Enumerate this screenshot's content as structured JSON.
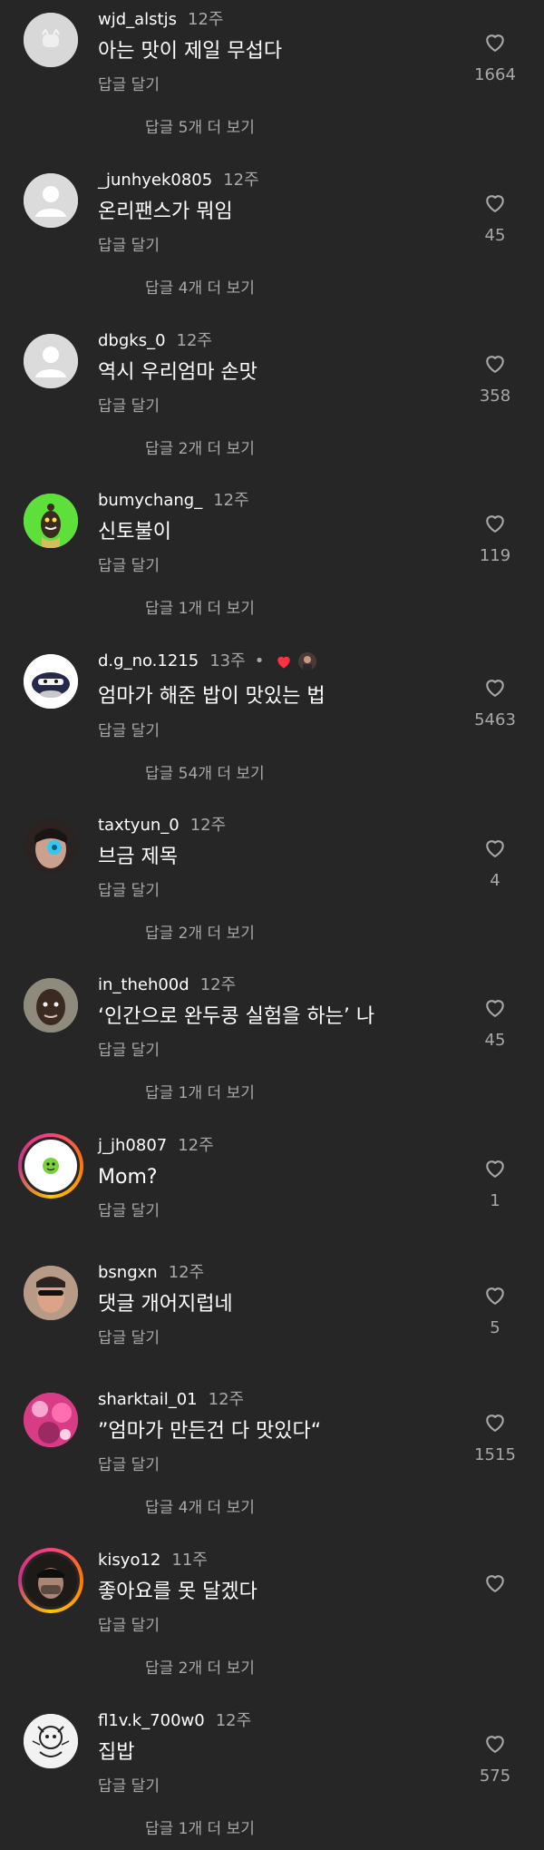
{
  "comments": [
    {
      "username": "wjd_alstjs",
      "time": "12주",
      "text": "아는 맛이 제일 무섭다",
      "reply_label": "답글 달기",
      "likes": "1664",
      "view_replies": "답글 5개 더 보기",
      "avatar": "blank-cat-avatar"
    },
    {
      "username": "_junhyek0805",
      "time": "12주",
      "text": "온리팬스가 뭐임",
      "reply_label": "답글 달기",
      "likes": "45",
      "view_replies": "답글 4개 더 보기",
      "avatar": "default-avatar"
    },
    {
      "username": "dbgks_0",
      "time": "12주",
      "text": "역시 우리엄마 손맛",
      "reply_label": "답글 달기",
      "likes": "358",
      "view_replies": "답글 2개 더 보기",
      "avatar": "default-avatar"
    },
    {
      "username": "bumychang_",
      "time": "12주",
      "text": "신토불이",
      "reply_label": "답글 달기",
      "likes": "119",
      "view_replies": "답글 1개 더 보기",
      "avatar": "character-avatar"
    },
    {
      "username": "d.g_no.1215",
      "time": "13주",
      "dot": "•",
      "text": "엄마가 해준 밥이 맛있는 법",
      "reply_label": "답글 달기",
      "likes": "5463",
      "view_replies": "답글 54개 더 보기",
      "avatar": "penguin-avatar",
      "liked_by_author": true
    },
    {
      "username": "taxtyun_0",
      "time": "12주",
      "text": "브금 제목",
      "reply_label": "답글 달기",
      "likes": "4",
      "view_replies": "답글 2개 더 보기",
      "avatar": "face-photo-avatar"
    },
    {
      "username": "in_theh00d",
      "time": "12주",
      "text": "‘인간으로 완두콩 실험을 하는’ 나",
      "reply_label": "답글 달기",
      "likes": "45",
      "view_replies": "답글 1개 더 보기",
      "avatar": "man-photo-avatar"
    },
    {
      "username": "j_jh0807",
      "time": "12주",
      "text": "Mom?",
      "reply_label": "답글 달기",
      "likes": "1",
      "avatar": "story-ring-avatar"
    },
    {
      "username": "bsngxn",
      "time": "12주",
      "text": "댓글 개어지럽네",
      "reply_label": "답글 달기",
      "likes": "5",
      "avatar": "sunglasses-photo-avatar"
    },
    {
      "username": "sharktail_01",
      "time": "12주",
      "text": "”엄마가 만든건 다 맛있다“",
      "reply_label": "답글 달기",
      "likes": "1515",
      "view_replies": "답글 4개 더 보기",
      "avatar": "pink-photo-avatar"
    },
    {
      "username": "kisyo12",
      "time": "11주",
      "text": "좋아요를 못 달겠다",
      "reply_label": "답글 달기",
      "likes": "",
      "view_replies": "답글 2개 더 보기",
      "avatar": "story-ring-dark-avatar"
    },
    {
      "username": "fl1v.k_700w0",
      "time": "12주",
      "text": "집밥",
      "reply_label": "답글 달기",
      "likes": "575",
      "view_replies": "답글 1개 더 보기",
      "avatar": "sketch-avatar"
    }
  ],
  "colors": {
    "background": "#262626",
    "primary_text": "#ffffff",
    "secondary_text": "#a8a8a8",
    "liked_heart": "#ff3040"
  }
}
